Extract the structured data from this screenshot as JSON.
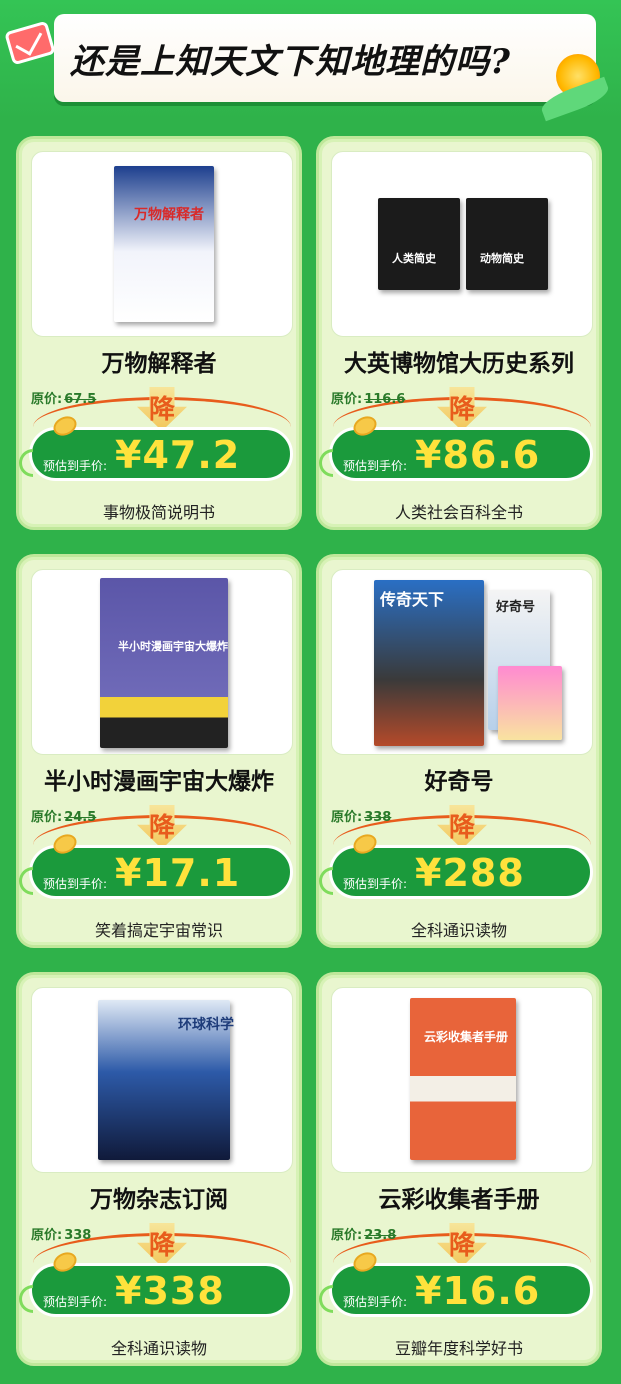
{
  "header": {
    "title": "还是上知天文下知地理的吗?"
  },
  "labels": {
    "orig_prefix": "原价:",
    "drop": "降",
    "estimated": "预估到手价:",
    "currency": "¥"
  },
  "books": [
    {
      "name": "万物解释者",
      "orig": "67.5",
      "orig_struck": true,
      "price": "47.2",
      "tagline": "事物极简说明书",
      "cover_text": "万物解释者"
    },
    {
      "name": "大英博物馆大历史系列",
      "orig": "116.6",
      "orig_struck": true,
      "price": "86.6",
      "tagline": "人类社会百科全书",
      "cover_text_a": "人类简史",
      "cover_text_b": "动物简史"
    },
    {
      "name": "半小时漫画宇宙大爆炸",
      "orig": "24.5",
      "orig_struck": true,
      "price": "17.1",
      "tagline": "笑着搞定宇宙常识",
      "cover_text": "半小时漫画宇宙大爆炸"
    },
    {
      "name": "好奇号",
      "orig": "338",
      "orig_struck": true,
      "price": "288",
      "tagline": "全科通识读物",
      "cover_text_a": "传奇天下",
      "cover_text_b": "好奇号"
    },
    {
      "name": "万物杂志订阅",
      "orig": "338",
      "orig_struck": false,
      "price": "338",
      "tagline": "全科通识读物",
      "cover_text": "环球科学"
    },
    {
      "name": "云彩收集者手册",
      "orig": "23.8",
      "orig_struck": true,
      "price": "16.6",
      "tagline": "豆瓣年度科学好书",
      "cover_text": "云彩收集者手册"
    }
  ],
  "colors": {
    "background": "#2fb24a",
    "price_bar": "#1b9a3c",
    "price_text": "#ffe23c",
    "accent": "#e85c1c"
  }
}
